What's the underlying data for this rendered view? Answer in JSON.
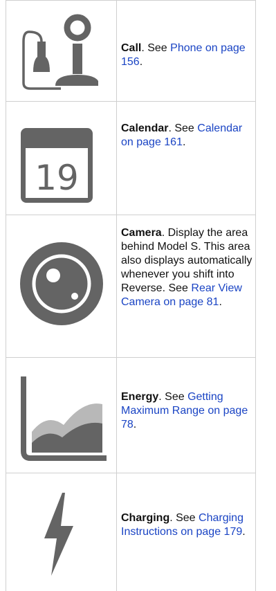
{
  "colors": {
    "icon": "#646464",
    "link": "#1a44c4",
    "border": "#cfcfcf",
    "text": "#111111"
  },
  "rows": [
    {
      "icon": "phone-icon",
      "title": "Call",
      "pre": ". See ",
      "link": "Phone on page 156",
      "post": "."
    },
    {
      "icon": "calendar-icon",
      "title": "Calendar",
      "pre": ". See ",
      "link": "Calendar on page 161",
      "post": ".",
      "calendar_day": "19"
    },
    {
      "icon": "camera-icon",
      "title": "Camera",
      "pre": ". Display the area behind Model S. This area also displays automatically whenever you shift into Reverse. See ",
      "link": "Rear View Camera on page 81",
      "post": "."
    },
    {
      "icon": "energy-icon",
      "title": "Energy",
      "pre": ". See ",
      "link": "Getting Maximum Range on page 78",
      "post": "."
    },
    {
      "icon": "charging-icon",
      "title": "Charging",
      "pre": ". See ",
      "link": "Charging Instructions on page 179",
      "post": "."
    }
  ]
}
